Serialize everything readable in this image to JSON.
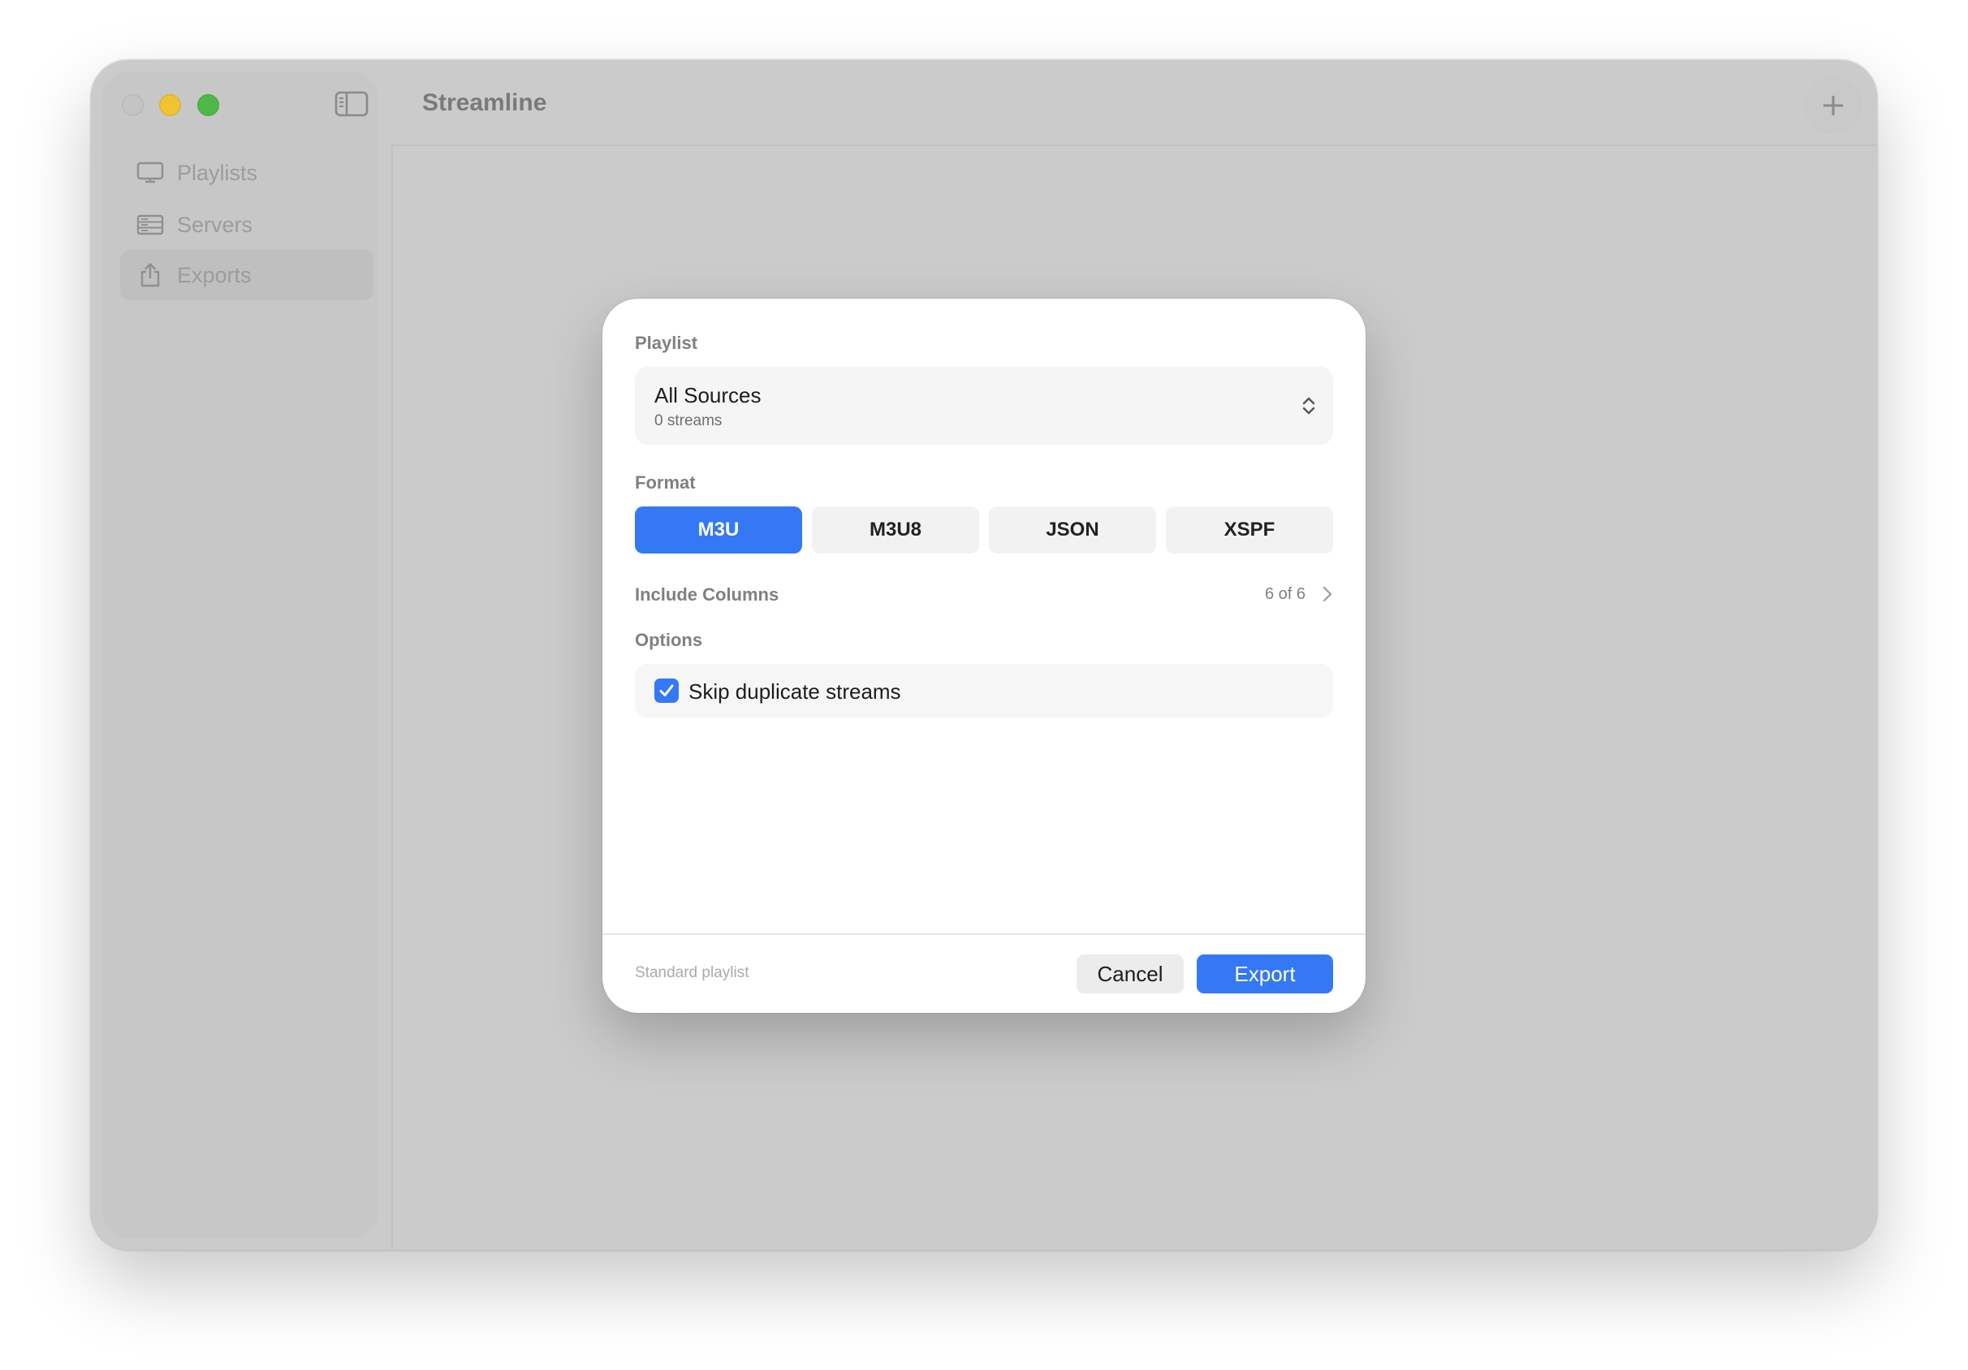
{
  "app": {
    "title": "Streamline"
  },
  "sidebar": {
    "items": [
      {
        "label": "Playlists",
        "icon": "monitor-icon",
        "selected": false
      },
      {
        "label": "Servers",
        "icon": "server-icon",
        "selected": false
      },
      {
        "label": "Exports",
        "icon": "share-icon",
        "selected": true
      }
    ]
  },
  "dialog": {
    "playlist_label": "Playlist",
    "playlist": {
      "title": "All Sources",
      "subtitle": "0 streams"
    },
    "format_label": "Format",
    "formats": [
      {
        "label": "M3U",
        "selected": true
      },
      {
        "label": "M3U8",
        "selected": false
      },
      {
        "label": "JSON",
        "selected": false
      },
      {
        "label": "XSPF",
        "selected": false
      }
    ],
    "include_columns": {
      "label": "Include Columns",
      "count": "6 of 6"
    },
    "options_label": "Options",
    "options": [
      {
        "label": "Skip duplicate streams",
        "checked": true
      }
    ],
    "footer": {
      "hint": "Standard playlist",
      "cancel_label": "Cancel",
      "export_label": "Export"
    }
  },
  "colors": {
    "accent": "#3478f6",
    "traffic_close": "#c4c4c4",
    "traffic_minimize": "#f1c232",
    "traffic_maximize": "#50b848"
  }
}
